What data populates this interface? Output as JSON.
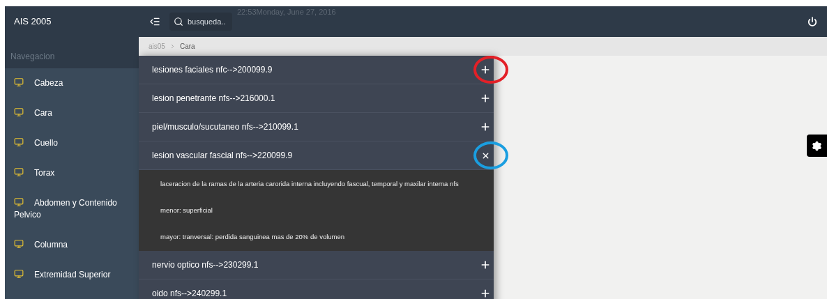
{
  "header": {
    "brand": "AIS 2005",
    "search": {
      "placeholder": "busqueda.."
    },
    "datetime": "22:53Monday, June 27, 2016"
  },
  "sidebar": {
    "heading": "Navegacion",
    "items": [
      {
        "label": "Cabeza"
      },
      {
        "label": "Cara"
      },
      {
        "label": "Cuello"
      },
      {
        "label": "Torax"
      },
      {
        "label": "Abdomen y Contenido Pelvico"
      },
      {
        "label": "Columna"
      },
      {
        "label": "Extremidad Superior"
      }
    ]
  },
  "breadcrumb": [
    "ais05",
    "Cara"
  ],
  "accordion": [
    {
      "title": "lesiones faciales nfc-->200099.9",
      "expanded": false,
      "color": "#e32027"
    },
    {
      "title": "lesion penetrante nfs-->216000.1",
      "expanded": false
    },
    {
      "title": "piel/musculo/sucutaneo nfs-->210099.1",
      "expanded": false
    },
    {
      "title": "lesion vascular fascial nfs-->220099.9",
      "expanded": true,
      "color": "#1a9ee0",
      "children": [
        "laceracion de la ramas de la arteria carorida interna incluyendo fascual, temporal y maxilar interna nfs",
        "menor: superficial",
        "mayor: tranversal: perdida sanguinea mas de 20% de volumen"
      ]
    },
    {
      "title": "nervio optico nfs-->230299.1",
      "expanded": false
    },
    {
      "title": "oido nfs-->240299.1",
      "expanded": false
    }
  ]
}
